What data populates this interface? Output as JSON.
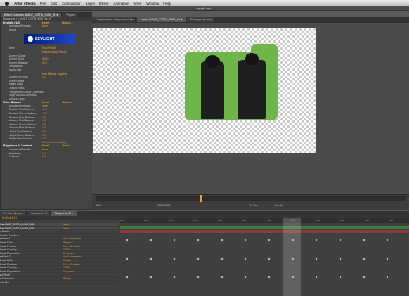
{
  "menubar": {
    "app_name": "After Effects",
    "items": [
      "File",
      "Edit",
      "Composition",
      "Layer",
      "Effect",
      "Animation",
      "View",
      "Window",
      "Help"
    ],
    "window_title": "keylight.aep *"
  },
  "effect_panel": {
    "tabs": [
      "Effect Controls: ANNT_CSTN_0050_M ▾",
      "Project"
    ],
    "heading": "Sequence 5 • ANNT_CSTN_0050_M • B",
    "logo_text": "KEYLIGHT",
    "rows": [
      {
        "label": "Keylight (1.2)",
        "value": "Reset",
        "value2": "About...",
        "cls": "hdr"
      },
      {
        "label": "Animation Presets",
        "value": "None",
        "value2": "",
        "cls": "sub"
      },
      {
        "label": "About",
        "value": "",
        "value2": "",
        "cls": "sub"
      },
      {
        "label": "View",
        "value": "Final Result",
        "value2": "",
        "cls": "sub"
      },
      {
        "label": "",
        "value": "Unpremultiply Result",
        "value2": "",
        "cls": "sub"
      },
      {
        "label": "Screen Colour",
        "value": "",
        "value2": "",
        "cls": "sub"
      },
      {
        "label": "Screen Gain",
        "value": "100.0",
        "value2": "",
        "cls": "sub"
      },
      {
        "label": "Screen Balance",
        "value": "50.0",
        "value2": "",
        "cls": "sub"
      },
      {
        "label": "Despill Bias",
        "value": "",
        "value2": "",
        "cls": "sub"
      },
      {
        "label": "Alpha Bias",
        "value": "",
        "value2": "",
        "cls": "sub"
      },
      {
        "label": "",
        "value": "Lock Biases Together",
        "value2": "",
        "cls": "sub"
      },
      {
        "label": "Screen Pre-blur",
        "value": "0.0",
        "value2": "",
        "cls": "sub"
      },
      {
        "label": "Screen Matte",
        "value": "",
        "value2": "",
        "cls": "sub"
      },
      {
        "label": "Inside Mask",
        "value": "",
        "value2": "",
        "cls": "sub"
      },
      {
        "label": "Outside Mask",
        "value": "",
        "value2": "",
        "cls": "sub"
      },
      {
        "label": "Foreground Colour Correction",
        "value": "",
        "value2": "",
        "cls": "sub"
      },
      {
        "label": "Edge Colour Correction",
        "value": "",
        "value2": "",
        "cls": "sub"
      },
      {
        "label": "Source Crops",
        "value": "",
        "value2": "",
        "cls": "sub"
      },
      {
        "label": "Color Balance",
        "value": "Reset",
        "value2": "About...",
        "cls": "hdr"
      },
      {
        "label": "Animation Presets",
        "value": "None",
        "value2": "",
        "cls": "sub"
      },
      {
        "label": "Shadow Red Balance",
        "value": "-3.0",
        "value2": "",
        "cls": "sub"
      },
      {
        "label": "Shadow Green Balance",
        "value": "-2.0",
        "value2": "",
        "cls": "sub"
      },
      {
        "label": "Shadow Blue Balance",
        "value": "0.0",
        "value2": "",
        "cls": "sub"
      },
      {
        "label": "Midtone Red Balance",
        "value": "0.0",
        "value2": "",
        "cls": "sub"
      },
      {
        "label": "Midtone Green Balance",
        "value": "0.0",
        "value2": "",
        "cls": "sub"
      },
      {
        "label": "Midtone Blue Balance",
        "value": "0.0",
        "value2": "",
        "cls": "sub"
      },
      {
        "label": "Hilight Red Balance",
        "value": "0.0",
        "value2": "",
        "cls": "sub"
      },
      {
        "label": "Hilight Green Balance",
        "value": "0.0",
        "value2": "",
        "cls": "sub"
      },
      {
        "label": "Hilight Blue Balance",
        "value": "0.0",
        "value2": "",
        "cls": "sub"
      },
      {
        "label": "",
        "value": "Preserve Luminosity",
        "value2": "",
        "cls": "sub"
      },
      {
        "label": "Brightness & Contrast",
        "value": "Reset",
        "value2": "About...",
        "cls": "hdr"
      },
      {
        "label": "Animation Presets",
        "value": "None",
        "value2": "",
        "cls": "sub"
      },
      {
        "label": "Brightness",
        "value": "0.0",
        "value2": "",
        "cls": "sub"
      },
      {
        "label": "Contrast",
        "value": "8.0",
        "value2": "",
        "cls": "sub"
      }
    ]
  },
  "comp_panel": {
    "tabs": [
      "Composition: Sequence 5 ▾",
      "Layer: ANNT_CSTN_0050_M ▾",
      "Footage: (none)"
    ],
    "controls": {
      "zoom": "50%",
      "timecode": "0:00:44:02",
      "resolution": "Half",
      "view": "1 View",
      "camera": "Active Camera",
      "render": "Render"
    }
  },
  "timeline": {
    "tabs": [
      "Render Queue",
      "Sequence 1",
      "Sequence 5 ×"
    ],
    "current_time": "0:00:44:17",
    "ruler_ticks": [
      "00s",
      "05s",
      "10s",
      "15s",
      "20s",
      "25s",
      "30s",
      "35s",
      "40s",
      "45s",
      "50s",
      "55s"
    ],
    "rows": [
      {
        "label": "1  ■ ANNT_CSTN_0050_M.B",
        "value": "None",
        "cls": "layer"
      },
      {
        "label": "2  ■ ANNT_CSTN_0050_M.B",
        "value": "None",
        "cls": "layer"
      },
      {
        "label": "  ▾ Masks",
        "value": "",
        "cls": ""
      },
      {
        "label": "    Motion Trackers",
        "value": "",
        "cls": ""
      },
      {
        "label": "    ▾ Mask 1",
        "value": "Add  ▾  Inverted",
        "cls": ""
      },
      {
        "label": "       Mask Path",
        "value": "Shape...",
        "cls": ""
      },
      {
        "label": "       Mask Feather",
        "value": "0.0, 0.0 pixels",
        "cls": ""
      },
      {
        "label": "       Mask Opacity",
        "value": "100%",
        "cls": ""
      },
      {
        "label": "       Mask Expansion",
        "value": "0.0 pixels",
        "cls": ""
      },
      {
        "label": "    ▾ Mask 2",
        "value": "Add  ▾  Inverted",
        "cls": ""
      },
      {
        "label": "       Mask Path",
        "value": "Shape...",
        "cls": ""
      },
      {
        "label": "       Mask Feather",
        "value": "0.0, 0.0 pixels",
        "cls": ""
      },
      {
        "label": "       Mask Opacity",
        "value": "100%",
        "cls": ""
      },
      {
        "label": "       Mask Expansion",
        "value": "0.0 pixels",
        "cls": ""
      },
      {
        "label": "  ▸ Effects",
        "value": "",
        "cls": ""
      },
      {
        "label": "  ▸ Transform",
        "value": "Reset",
        "cls": ""
      },
      {
        "label": "  ▸ Audio",
        "value": "",
        "cls": ""
      }
    ]
  },
  "colors": {
    "matte_green": "#70b54a",
    "value_orange": "#e3a33a",
    "bar_green": "#3d7a3d",
    "bar_red": "#8a3a3a"
  }
}
